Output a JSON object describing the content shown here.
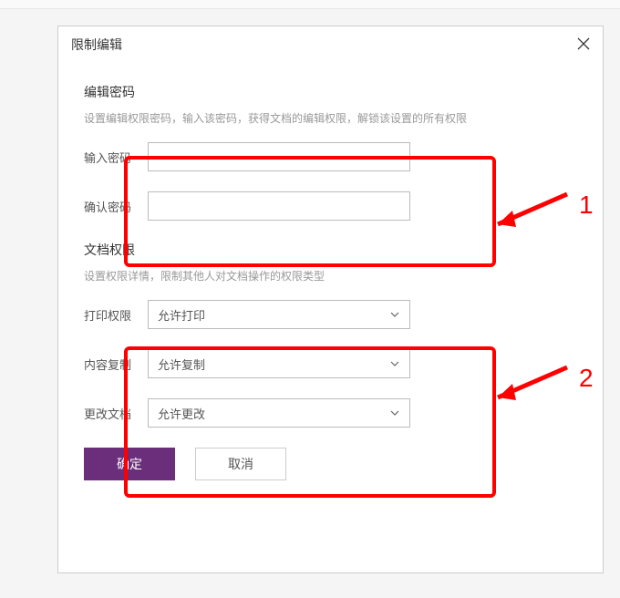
{
  "dialog": {
    "title": "限制编辑",
    "section1": {
      "title": "编辑密码",
      "desc": "设置编辑权限密码，输入该密码，获得文档的编辑权限，解锁该设置的所有权限",
      "password_label": "输入密码",
      "confirm_label": "确认密码"
    },
    "section2": {
      "title": "文档权限",
      "desc": "设置权限详情，限制其他人对文档操作的权限类型",
      "print_label": "打印权限",
      "print_value": "允许打印",
      "copy_label": "内容复制",
      "copy_value": "允许复制",
      "modify_label": "更改文档",
      "modify_value": "允许更改"
    },
    "buttons": {
      "ok": "确定",
      "cancel": "取消"
    }
  },
  "annotations": {
    "label1": "1",
    "label2": "2"
  }
}
